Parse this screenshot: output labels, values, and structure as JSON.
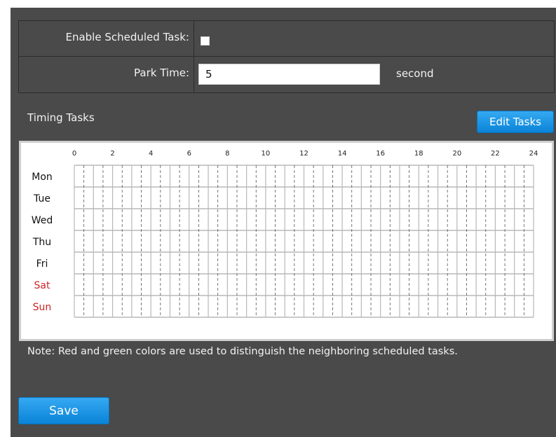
{
  "settings": {
    "enable_label": "Enable Scheduled Task:",
    "enable_checked": false,
    "park_label": "Park Time:",
    "park_value": "5",
    "park_unit": "second"
  },
  "timing": {
    "title": "Timing Tasks",
    "edit_label": "Edit Tasks",
    "hour_labels": [
      "0",
      "2",
      "4",
      "6",
      "8",
      "10",
      "12",
      "14",
      "16",
      "18",
      "20",
      "22",
      "24"
    ],
    "days": [
      {
        "label": "Mon",
        "weekend": false
      },
      {
        "label": "Tue",
        "weekend": false
      },
      {
        "label": "Wed",
        "weekend": false
      },
      {
        "label": "Thu",
        "weekend": false
      },
      {
        "label": "Fri",
        "weekend": false
      },
      {
        "label": "Sat",
        "weekend": true
      },
      {
        "label": "Sun",
        "weekend": true
      }
    ],
    "hours_per_day": 24,
    "scheduled_slots": []
  },
  "note": "Note: Red and green colors are used to distinguish the neighboring scheduled tasks.",
  "save_label": "Save",
  "colors": {
    "panel_bg": "#4a4a4a",
    "button_blue": "#1a93e3",
    "weekend_red": "#cc2222",
    "weekday_text": "#111111",
    "grid_line": "#b8b8b8"
  }
}
